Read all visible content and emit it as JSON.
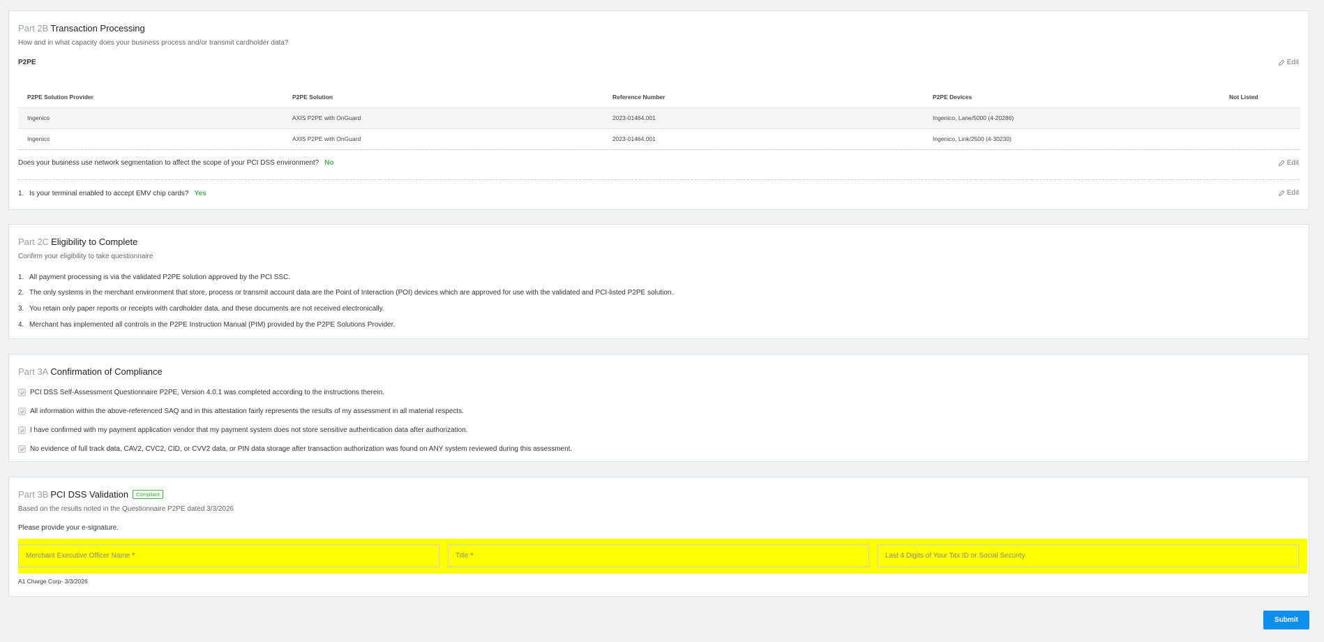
{
  "part2b": {
    "part_num": "Part 2B",
    "title": "Transaction Processing",
    "subtitle": "How and in what capacity does your business process and/or transmit cardholder data?",
    "section_label": "P2PE",
    "edit_label": "Edit",
    "table": {
      "headers": [
        "P2PE Solution Provider",
        "P2PE Solution",
        "Reference Number",
        "P2PE Devices",
        "Not Listed"
      ],
      "rows": [
        [
          "Ingenico",
          "AXIS P2PE with OnGuard",
          "2023-01464.001",
          "Ingenico, Lane/5000 (4-20286)",
          ""
        ],
        [
          "Ingenico",
          "AXIS P2PE with OnGuard",
          "2023-01464.001",
          "Ingenico, Link/2500 (4-30230)",
          ""
        ]
      ]
    },
    "segmentation_question": "Does your business use network segmentation to affect the scope of your PCI DSS environment?",
    "segmentation_answer": "No",
    "emv_num": "1.",
    "emv_question": "Is your terminal enabled to accept EMV chip cards?",
    "emv_answer": "Yes"
  },
  "part2c": {
    "part_num": "Part 2C",
    "title": "Eligibility to Complete",
    "subtitle": "Confirm your eligibility to take questionnaire",
    "items": [
      {
        "num": "1.",
        "text": "All payment processing is via the validated P2PE solution approved by the PCI SSC."
      },
      {
        "num": "2.",
        "text": "The only systems in the merchant environment that store, process or transmit account data are the Point of Interaction (POI) devices which are approved for use with the validated and PCI-listed P2PE solution."
      },
      {
        "num": "3.",
        "text": "You retain only paper reports or receipts with cardholder data, and these documents are not received electronically."
      },
      {
        "num": "4.",
        "text": "Merchant has implemented all controls in the P2PE Instruction Manual (PIM) provided by the P2PE Solutions Provider."
      }
    ]
  },
  "part3a": {
    "part_num": "Part 3A",
    "title": "Confirmation of Compliance",
    "items": [
      "PCI DSS Self-Assessment Questionnaire P2PE, Version 4.0.1 was completed according to the instructions therein.",
      "All information within the above-referenced SAQ and in this attestation fairly represents the results of my assessment in all material respects.",
      "I have confirmed with my payment application vendor that my payment system does not store sensitive authentication data after authorization.",
      "No evidence of full track data, CAV2, CVC2, CID, or CVV2 data, or PIN data storage after transaction authorization was found on ANY system reviewed during this assessment."
    ]
  },
  "part3b": {
    "part_num": "Part 3B",
    "title": "PCI DSS Validation",
    "badge": "Compliant",
    "subtitle": "Based on the results noted in the Questionnaire P2PE dated 3/3/2026",
    "prompt": "Please provide your e-signature.",
    "fields": {
      "officer_placeholder": "Merchant Executive Officer Name",
      "title_placeholder": "Title",
      "tax_placeholder": "Last 4 Digits of Your Tax ID or Social Security",
      "required_mark": "*"
    },
    "footer_note": "A1 Charge Corp- 3/3/2026"
  },
  "submit_label": "Submit",
  "colors": {
    "accent": "#0d8ff0",
    "success": "#4caf50",
    "highlight": "#ffff00"
  }
}
